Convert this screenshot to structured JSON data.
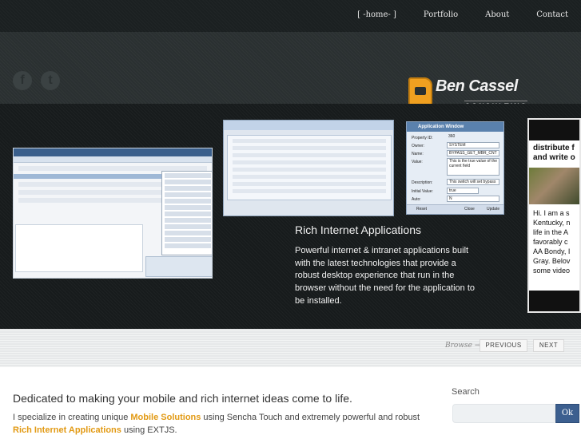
{
  "nav": {
    "items": [
      "[ -home- ]",
      "Portfolio",
      "About",
      "Contact"
    ]
  },
  "social": {
    "facebook_icon": "f",
    "twitter_icon": "t"
  },
  "logo": {
    "name": "Ben Cassel",
    "subtitle": "CONSULTING"
  },
  "slider": {
    "title": "Rich Internet Applications",
    "description": "Powerful internet & intranet applications built with the latest technologies that provide a robust desktop experience that run in the browser without the need for the application to be installed.",
    "app_window": {
      "title": "Application Window",
      "fields": [
        {
          "label": "Property ID:",
          "value": "360"
        },
        {
          "label": "Owner:",
          "value": "SYSTEM"
        },
        {
          "label": "Name:",
          "value": "BYPASS_GET_MBR_CNT"
        },
        {
          "label": "Value:",
          "value": "This is the true value of the current field"
        },
        {
          "label": "Description:",
          "value": "This switch will set bypass"
        },
        {
          "label": "Initial Value:",
          "value": "true"
        },
        {
          "label": "Auto:",
          "value": "N"
        }
      ],
      "buttons": {
        "reset": "Reset",
        "close": "Close",
        "update": "Update"
      }
    },
    "right_preview": {
      "heading": [
        "distribute f",
        "and write o"
      ],
      "text": [
        "Hi. I am a s",
        "Kentucky, n",
        "life in the A",
        "favorably c",
        "AA Bondy, I",
        "Gray. Belov",
        "some video"
      ]
    }
  },
  "browse": {
    "label": "Browse →",
    "previous": "PREVIOUS",
    "next": "NEXT"
  },
  "content": {
    "title": "Dedicated to making your mobile and rich internet ideas come to life.",
    "text_1": "I specialize in creating unique ",
    "highlight_1": "Mobile Solutions",
    "text_2": " using Sencha Touch and extremely powerful and robust ",
    "highlight_2": "Rich Internet Applications",
    "text_3": " using EXTJS."
  },
  "search": {
    "label": "Search",
    "placeholder": "",
    "button": "Ok"
  },
  "colors": {
    "accent": "#e29a14",
    "dark": "#1b2021",
    "button_blue": "#3c5f8f"
  }
}
